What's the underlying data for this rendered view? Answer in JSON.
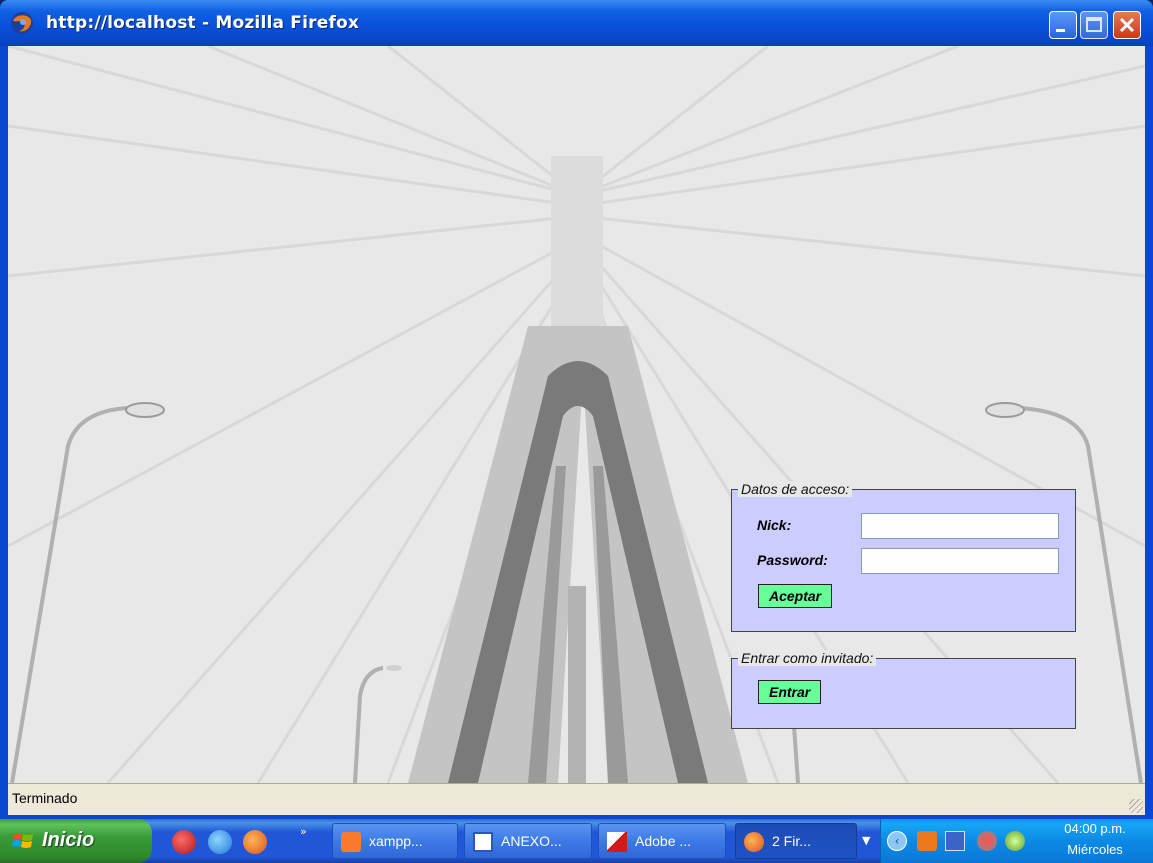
{
  "window": {
    "title": "http://localhost - Mozilla Firefox",
    "icon": "firefox-icon"
  },
  "login": {
    "access_legend": "Datos de acceso:",
    "nick_label": "Nick:",
    "nick_value": "",
    "password_label": "Password:",
    "password_value": "",
    "accept_button": "Aceptar",
    "guest_legend": "Entrar como invitado:",
    "guest_button": "Entrar",
    "panel_color": "#ccccff",
    "button_color": "#66ff99"
  },
  "statusbar": {
    "text": "Terminado"
  },
  "taskbar": {
    "start_label": "Inicio",
    "quick_launch": [
      "gmail-icon",
      "internet-explorer-icon",
      "firefox-icon"
    ],
    "more": "»",
    "tasks": [
      {
        "label": "xampp...",
        "icon": "xampp-icon"
      },
      {
        "label": "ANEXO...",
        "icon": "word-icon"
      },
      {
        "label": "Adobe ...",
        "icon": "adobe-icon"
      },
      {
        "label": "2 Fir...",
        "icon": "firefox-icon"
      }
    ],
    "tray_icons": [
      "java-icon",
      "network-icon",
      "security-icon",
      "award-icon"
    ],
    "clock_time": "04:00 p.m.",
    "clock_day": "Miércoles"
  }
}
